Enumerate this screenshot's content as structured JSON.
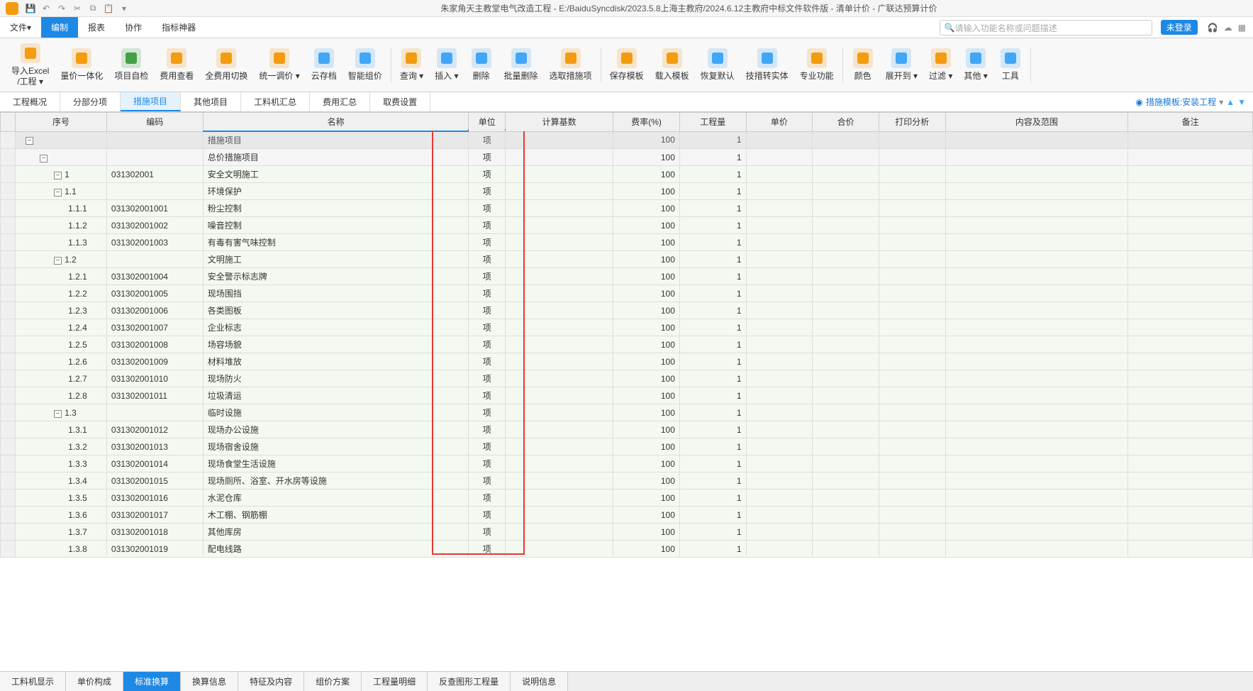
{
  "window": {
    "title": "朱家角天主教堂电气改造工程 - E:/BaiduSyncdisk/2023.5.8上海主教府/2024.6.12主教府中标文件软件版 - 清单计价 - 广联达预算计价"
  },
  "menu": [
    "文件▾",
    "编制",
    "报表",
    "协作",
    "指标神器"
  ],
  "menu_active_index": 1,
  "search_placeholder": "请输入功能名称或问题描述",
  "login_label": "未登录",
  "toolbar": [
    {
      "label": "导入Excel\n/工程 ▾",
      "color": "#f39c12"
    },
    {
      "label": "量价一体化",
      "color": "#f39c12"
    },
    {
      "label": "项目自检",
      "color": "#43a047"
    },
    {
      "label": "费用查看",
      "color": "#f39c12"
    },
    {
      "label": "全费用切换",
      "color": "#f39c12"
    },
    {
      "label": "统一调价 ▾",
      "color": "#f39c12"
    },
    {
      "label": "云存档",
      "color": "#42a5f5"
    },
    {
      "label": "智能组价",
      "color": "#42a5f5"
    },
    {
      "label": "查询 ▾",
      "color": "#f39c12"
    },
    {
      "label": "插入 ▾",
      "color": "#42a5f5"
    },
    {
      "label": "删除",
      "color": "#42a5f5"
    },
    {
      "label": "批量删除",
      "color": "#42a5f5"
    },
    {
      "label": "选取措施项",
      "color": "#f39c12"
    },
    {
      "label": "保存模板",
      "color": "#f39c12"
    },
    {
      "label": "载入模板",
      "color": "#f39c12"
    },
    {
      "label": "恢复默认",
      "color": "#42a5f5"
    },
    {
      "label": "技措转实体",
      "color": "#42a5f5"
    },
    {
      "label": "专业功能",
      "color": "#f39c12"
    },
    {
      "label": "颜色",
      "color": "#f39c12"
    },
    {
      "label": "展开到 ▾",
      "color": "#42a5f5"
    },
    {
      "label": "过滤 ▾",
      "color": "#f39c12"
    },
    {
      "label": "其他 ▾",
      "color": "#42a5f5"
    },
    {
      "label": "工具",
      "color": "#42a5f5"
    }
  ],
  "tabs": [
    "工程概况",
    "分部分项",
    "措施项目",
    "其他项目",
    "工料机汇总",
    "费用汇总",
    "取费设置"
  ],
  "tabs_active_index": 2,
  "template_label": "措施模板:安装工程",
  "columns": [
    "",
    "序号",
    "编码",
    "名称",
    "单位",
    "计算基数",
    "费率(%)",
    "工程量",
    "单价",
    "合价",
    "打印分析",
    "内容及范围",
    "备注"
  ],
  "rows": [
    {
      "type": "hdr",
      "toggle": "−",
      "idx": "",
      "code": "",
      "name": "措施项目",
      "unit": "项",
      "rate": "100",
      "qty": "1",
      "indent": 1
    },
    {
      "type": "group",
      "toggle": "−",
      "idx": "",
      "code": "",
      "name": "总价措施项目",
      "unit": "项",
      "rate": "100",
      "qty": "1",
      "indent": 2
    },
    {
      "type": "data",
      "toggle": "−",
      "idx": "1",
      "code": "031302001",
      "name": "安全文明施工",
      "unit": "项",
      "rate": "100",
      "qty": "1",
      "indent": 3
    },
    {
      "type": "data",
      "toggle": "−",
      "idx": "1.1",
      "code": "",
      "name": "环境保护",
      "unit": "项",
      "rate": "100",
      "qty": "1",
      "indent": 3
    },
    {
      "type": "data",
      "idx": "1.1.1",
      "code": "031302001001",
      "name": "粉尘控制",
      "unit": "项",
      "rate": "100",
      "qty": "1",
      "indent": 4
    },
    {
      "type": "data",
      "idx": "1.1.2",
      "code": "031302001002",
      "name": "噪音控制",
      "unit": "项",
      "rate": "100",
      "qty": "1",
      "indent": 4
    },
    {
      "type": "data",
      "idx": "1.1.3",
      "code": "031302001003",
      "name": "有毒有害气味控制",
      "unit": "项",
      "rate": "100",
      "qty": "1",
      "indent": 4
    },
    {
      "type": "data",
      "toggle": "−",
      "idx": "1.2",
      "code": "",
      "name": "文明施工",
      "unit": "项",
      "rate": "100",
      "qty": "1",
      "indent": 3
    },
    {
      "type": "data",
      "idx": "1.2.1",
      "code": "031302001004",
      "name": "安全警示标志牌",
      "unit": "项",
      "rate": "100",
      "qty": "1",
      "indent": 4
    },
    {
      "type": "data",
      "idx": "1.2.2",
      "code": "031302001005",
      "name": "现场围挡",
      "unit": "项",
      "rate": "100",
      "qty": "1",
      "indent": 4
    },
    {
      "type": "data",
      "idx": "1.2.3",
      "code": "031302001006",
      "name": "各类图板",
      "unit": "项",
      "rate": "100",
      "qty": "1",
      "indent": 4
    },
    {
      "type": "data",
      "idx": "1.2.4",
      "code": "031302001007",
      "name": "企业标志",
      "unit": "项",
      "rate": "100",
      "qty": "1",
      "indent": 4
    },
    {
      "type": "data",
      "idx": "1.2.5",
      "code": "031302001008",
      "name": "场容场貌",
      "unit": "项",
      "rate": "100",
      "qty": "1",
      "indent": 4
    },
    {
      "type": "data",
      "idx": "1.2.6",
      "code": "031302001009",
      "name": "材料堆放",
      "unit": "项",
      "rate": "100",
      "qty": "1",
      "indent": 4
    },
    {
      "type": "data",
      "idx": "1.2.7",
      "code": "031302001010",
      "name": "现场防火",
      "unit": "项",
      "rate": "100",
      "qty": "1",
      "indent": 4
    },
    {
      "type": "data",
      "idx": "1.2.8",
      "code": "031302001011",
      "name": "垃圾清运",
      "unit": "项",
      "rate": "100",
      "qty": "1",
      "indent": 4
    },
    {
      "type": "data",
      "toggle": "−",
      "idx": "1.3",
      "code": "",
      "name": "临时设施",
      "unit": "项",
      "rate": "100",
      "qty": "1",
      "indent": 3
    },
    {
      "type": "data",
      "idx": "1.3.1",
      "code": "031302001012",
      "name": "现场办公设施",
      "unit": "项",
      "rate": "100",
      "qty": "1",
      "indent": 4
    },
    {
      "type": "data",
      "idx": "1.3.2",
      "code": "031302001013",
      "name": "现场宿舍设施",
      "unit": "项",
      "rate": "100",
      "qty": "1",
      "indent": 4
    },
    {
      "type": "data",
      "idx": "1.3.3",
      "code": "031302001014",
      "name": "现场食堂生活设施",
      "unit": "项",
      "rate": "100",
      "qty": "1",
      "indent": 4
    },
    {
      "type": "data",
      "idx": "1.3.4",
      "code": "031302001015",
      "name": "现场厕所、浴室、开水房等设施",
      "unit": "项",
      "rate": "100",
      "qty": "1",
      "indent": 4
    },
    {
      "type": "data",
      "idx": "1.3.5",
      "code": "031302001016",
      "name": "水泥仓库",
      "unit": "项",
      "rate": "100",
      "qty": "1",
      "indent": 4
    },
    {
      "type": "data",
      "idx": "1.3.6",
      "code": "031302001017",
      "name": "木工棚、钢筋棚",
      "unit": "项",
      "rate": "100",
      "qty": "1",
      "indent": 4
    },
    {
      "type": "data",
      "idx": "1.3.7",
      "code": "031302001018",
      "name": "其他库房",
      "unit": "项",
      "rate": "100",
      "qty": "1",
      "indent": 4
    },
    {
      "type": "data",
      "idx": "1.3.8",
      "code": "031302001019",
      "name": "配电线路",
      "unit": "项",
      "rate": "100",
      "qty": "1",
      "indent": 4
    }
  ],
  "bottom_tabs": [
    "工料机显示",
    "单价构成",
    "标准换算",
    "换算信息",
    "特征及内容",
    "组价方案",
    "工程量明细",
    "反查图形工程量",
    "说明信息"
  ],
  "bottom_tabs_active_index": 2
}
